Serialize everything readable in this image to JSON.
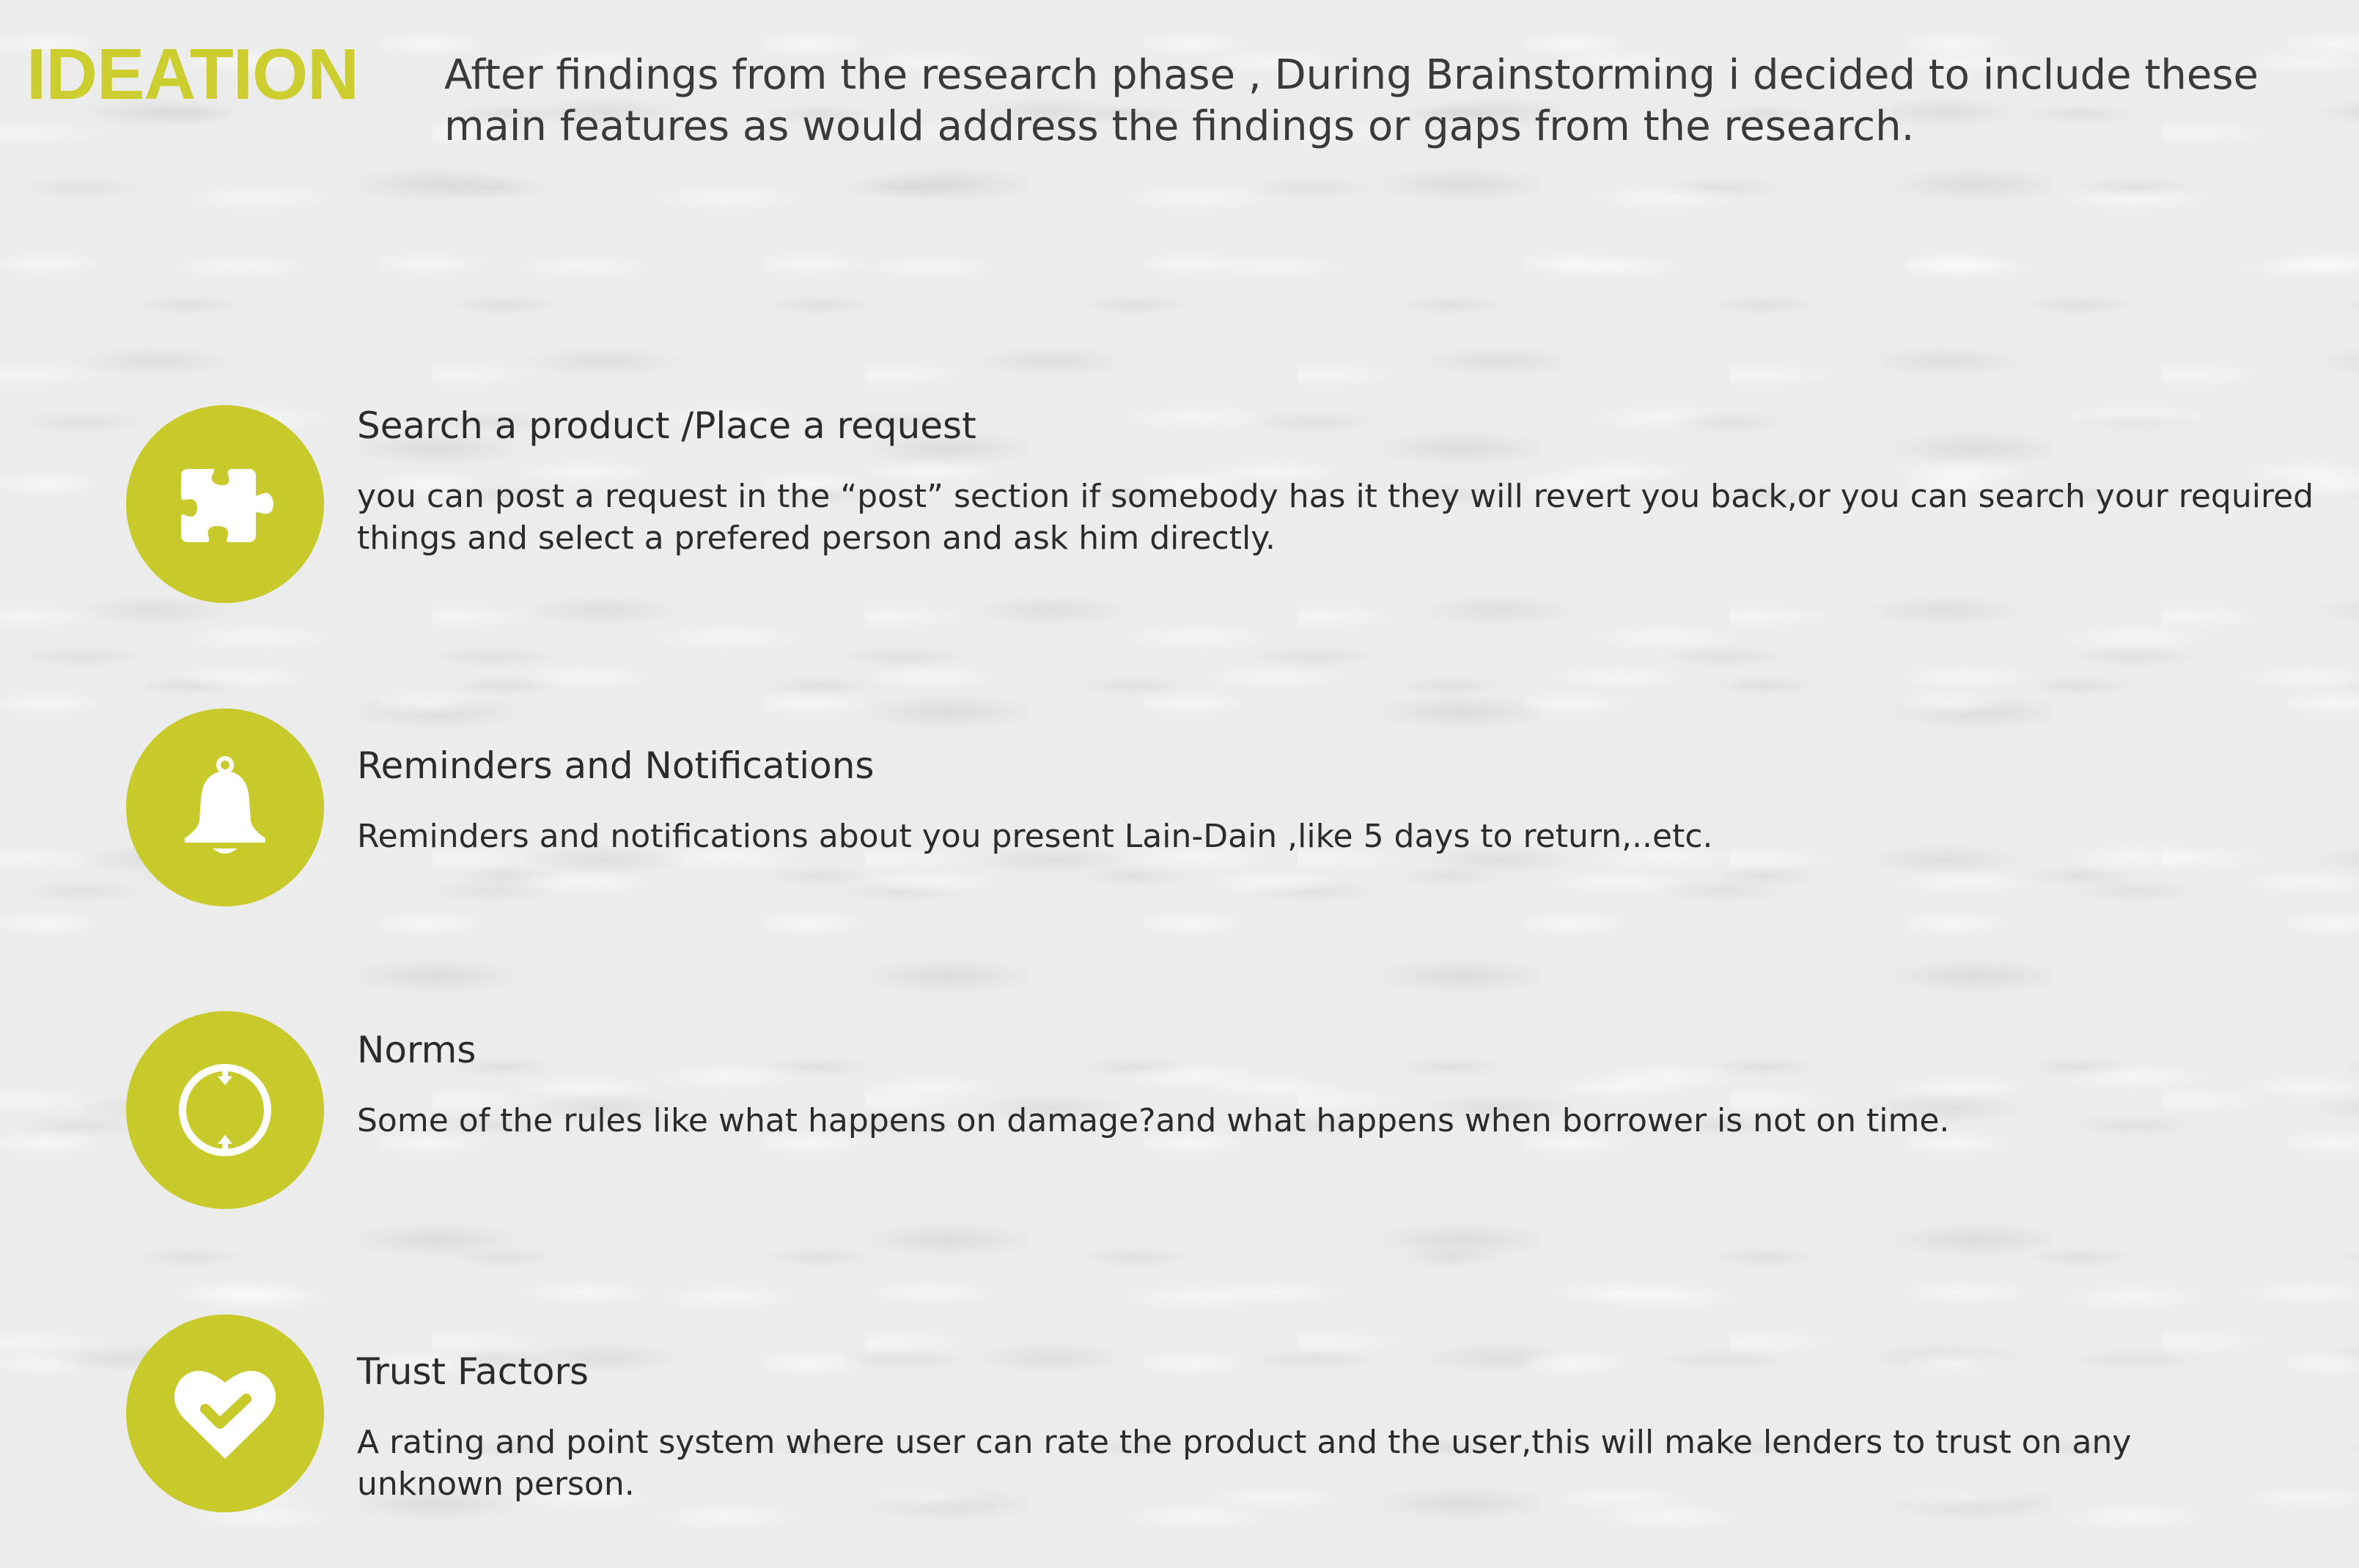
{
  "header": {
    "title": "IDEATION",
    "intro": "After findings from the research phase , During Brainstorming i decided to include these main features as would address the findings or gaps from the research."
  },
  "features": [
    {
      "icon": "puzzle-icon",
      "title": "Search a product /Place a request",
      "description": "you can post a request in the “post” section if somebody has it they will revert you back,or you can search your required things and select a prefered person and ask him directly."
    },
    {
      "icon": "bell-icon",
      "title": "Reminders and Notifications",
      "description": "Reminders and notifications about you present Lain-Dain ,like 5 days to return,..etc."
    },
    {
      "icon": "circle-arrows-icon",
      "title": "Norms",
      "description": "Some of the rules like what happens on damage?and what happens when borrower is not on time."
    },
    {
      "icon": "heart-check-icon",
      "title": "Trust Factors",
      "description": "A rating and point system where user can rate the product and the user,this will make lenders to trust on any unknown person."
    }
  ],
  "colors": {
    "accent": "#c8c92b",
    "title": "#cccd2e",
    "text": "#2b2b2b",
    "background": "#ececec"
  }
}
